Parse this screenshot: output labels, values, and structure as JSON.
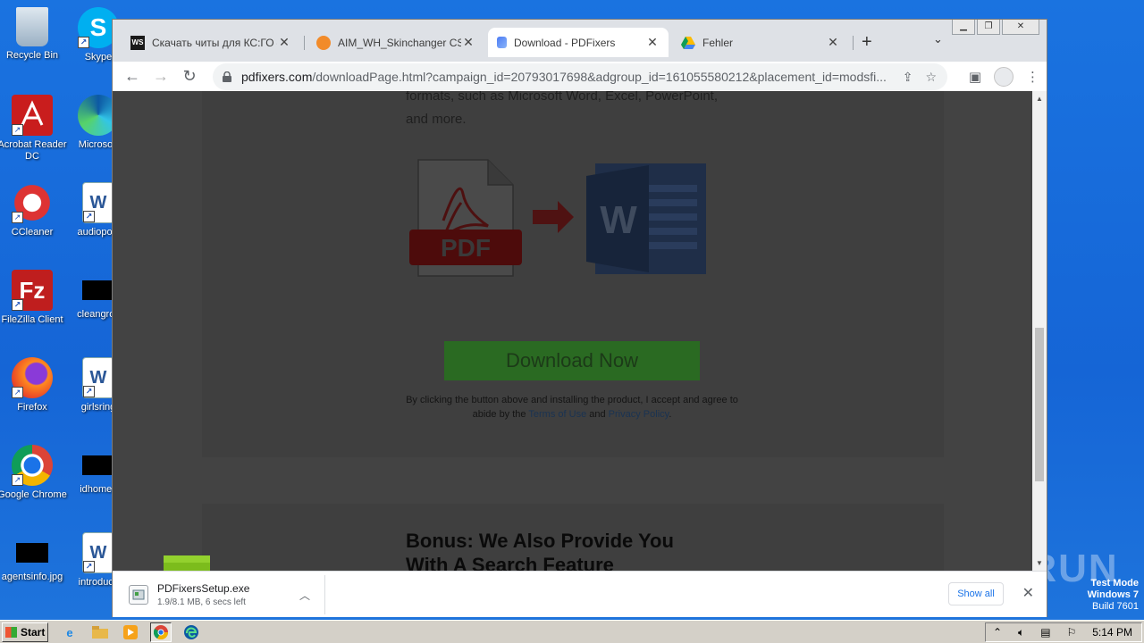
{
  "desktop": {
    "icons": [
      {
        "label": "Recycle Bin",
        "name": "recycle-bin"
      },
      {
        "label": "Skype",
        "name": "skype"
      },
      {
        "label": "Acrobat Reader DC",
        "name": "acrobat-reader"
      },
      {
        "label": "Microsoft",
        "name": "microsoft-edge"
      },
      {
        "label": "CCleaner",
        "name": "ccleaner"
      },
      {
        "label": "audiopolit",
        "name": "audiopolit"
      },
      {
        "label": "FileZilla Client",
        "name": "filezilla"
      },
      {
        "label": "cleangrov",
        "name": "cleangrov"
      },
      {
        "label": "Firefox",
        "name": "firefox"
      },
      {
        "label": "girlsring",
        "name": "girlsring"
      },
      {
        "label": "Google Chrome",
        "name": "google-chrome"
      },
      {
        "label": "idhomes",
        "name": "idhomes"
      },
      {
        "label": "agentsinfo.jpg",
        "name": "agentsinfo"
      },
      {
        "label": "introducti",
        "name": "introducti"
      }
    ]
  },
  "browser": {
    "tabs": [
      {
        "title": "Скачать читы для КС:ГО –",
        "active": false
      },
      {
        "title": "AIM_WH_Skinchanger CSGO",
        "active": false
      },
      {
        "title": "Download - PDFixers",
        "active": true
      },
      {
        "title": "Fehler",
        "active": false
      }
    ],
    "url_host": "pdfixers.com",
    "url_rest": "/downloadPage.html?campaign_id=20793017698&adgroup_id=161055580212&placement_id=modsfi...",
    "page": {
      "text_line1": "formats, such as Microsoft Word, Excel, PowerPoint,",
      "text_line2": "and more.",
      "pdf_label": "PDF",
      "word_label": "W",
      "download_button": "Download Now",
      "legal_prefix": "By clicking the button above and installing the product, I accept and agree to abide by the",
      "terms_link": "Terms of Use",
      "legal_and": "and",
      "privacy_link": "Privacy Policy",
      "legal_end": ".",
      "bonus_line1": "Bonus: We Also Provide You",
      "bonus_line2": "With A Search Feature"
    },
    "download_bar": {
      "filename": "PDFixersSetup.exe",
      "status": "1.9/8.1 MB, 6 secs left",
      "show_all": "Show all"
    }
  },
  "watermark": {
    "line1": "Test Mode",
    "line2": "Windows 7",
    "line3": "Build 7601",
    "anyrun": "ANY RUN"
  },
  "taskbar": {
    "start_label": "Start",
    "time": "5:14 PM"
  },
  "colors": {
    "desktop_blue": "#1a73e0",
    "download_green": "#2a6a22",
    "chrome_tab_bg": "#dee1e6"
  }
}
